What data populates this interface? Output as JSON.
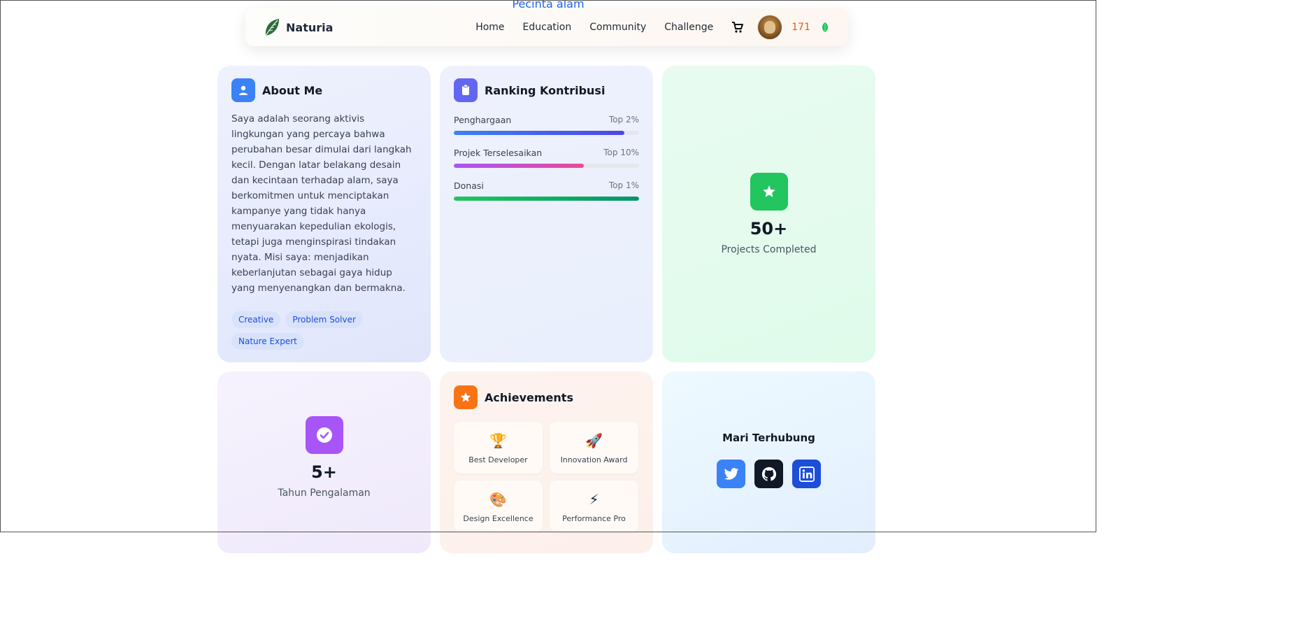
{
  "page": {
    "behind_heading": "Pecinta alam"
  },
  "navbar": {
    "brand": "Naturia",
    "links": [
      "Home",
      "Education",
      "Community",
      "Challenge"
    ],
    "points": "171",
    "icons": {
      "brand": "leaf-icon",
      "cart": "cart-icon",
      "points": "leaf-icon"
    },
    "colors": {
      "points": "#ea580c",
      "leaf": "#22c55e"
    }
  },
  "about": {
    "title": "About Me",
    "icon": "user-icon",
    "text": "Saya adalah seorang aktivis lingkungan yang percaya bahwa perubahan besar dimulai dari langkah kecil. Dengan latar belakang desain dan kecintaan terhadap alam, saya berkomitmen untuk menciptakan kampanye yang tidak hanya menyuarakan kepedulian ekologis, tetapi juga menginspirasi tindakan nyata. Misi saya: menjadikan keberlanjutan sebagai gaya hidup yang menyenangkan dan bermakna.",
    "tags": [
      "Creative",
      "Problem Solver",
      "Nature Expert"
    ]
  },
  "ranking": {
    "title": "Ranking Kontribusi",
    "icon": "clipboard-icon",
    "items": [
      {
        "label": "Penghargaan",
        "value": "Top 2%",
        "progress": 0.92,
        "gradient": [
          "#3b82f6",
          "#4f46e5"
        ]
      },
      {
        "label": "Projek Terselesaikan",
        "value": "Top 10%",
        "progress": 0.7,
        "gradient": [
          "#a855f7",
          "#ec4899"
        ]
      },
      {
        "label": "Donasi",
        "value": "Top 1%",
        "progress": 1.0,
        "gradient": [
          "#22c55e",
          "#059669"
        ]
      }
    ]
  },
  "projects": {
    "value": "50+",
    "label": "Projects Completed",
    "icon": "star-icon",
    "color": "#22c55e"
  },
  "experience": {
    "value": "5+",
    "label": "Tahun Pengalaman",
    "icon": "check-circle-icon",
    "color": "#a855f7"
  },
  "achievements": {
    "title": "Achievements",
    "icon": "star-icon",
    "items": [
      {
        "emoji": "🏆",
        "label": "Best Developer"
      },
      {
        "emoji": "🚀",
        "label": "Innovation Award"
      },
      {
        "emoji": "🎨",
        "label": "Design Excellence"
      },
      {
        "emoji": "⚡",
        "label": "Performance Pro"
      }
    ]
  },
  "connect": {
    "title": "Mari Terhubung",
    "socials": [
      {
        "name": "twitter-icon",
        "color": "#3b82f6"
      },
      {
        "name": "github-icon",
        "color": "#111827"
      },
      {
        "name": "linkedin-icon",
        "color": "#1d4ed8"
      }
    ]
  }
}
